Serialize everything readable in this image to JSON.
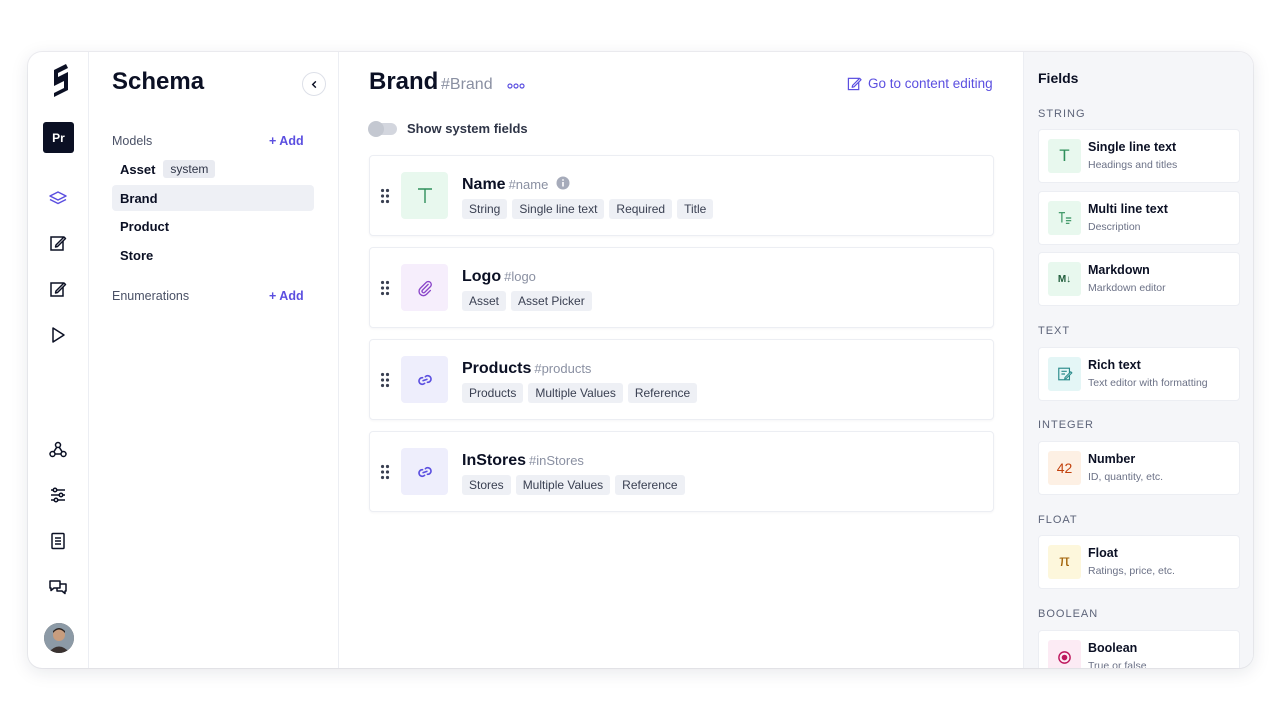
{
  "rail": {
    "project_initials": "Pr"
  },
  "schema": {
    "title": "Schema",
    "models_label": "Models",
    "enumerations_label": "Enumerations",
    "add_label": "+ Add",
    "models": [
      {
        "name": "Asset",
        "badge": "system"
      },
      {
        "name": "Brand"
      },
      {
        "name": "Product"
      },
      {
        "name": "Store"
      }
    ]
  },
  "main": {
    "title": "Brand",
    "api_id": "#Brand",
    "goto_label": "Go to content editing",
    "toggle_label": "Show system fields",
    "fields": [
      {
        "name": "Name",
        "api": "#name",
        "tags": [
          "String",
          "Single line text",
          "Required",
          "Title"
        ]
      },
      {
        "name": "Logo",
        "api": "#logo",
        "tags": [
          "Asset",
          "Asset Picker"
        ]
      },
      {
        "name": "Products",
        "api": "#products",
        "tags": [
          "Products",
          "Multiple Values",
          "Reference"
        ]
      },
      {
        "name": "InStores",
        "api": "#inStores",
        "tags": [
          "Stores",
          "Multiple Values",
          "Reference"
        ]
      }
    ]
  },
  "fields_panel": {
    "title": "Fields",
    "categories": [
      {
        "label": "STRING",
        "types": [
          {
            "name": "Single line text",
            "desc": "Headings and titles",
            "glyph": "T"
          },
          {
            "name": "Multi line text",
            "desc": "Description",
            "glyph": ""
          },
          {
            "name": "Markdown",
            "desc": "Markdown editor",
            "glyph": "M↓"
          }
        ]
      },
      {
        "label": "TEXT",
        "types": [
          {
            "name": "Rich text",
            "desc": "Text editor with formatting",
            "glyph": ""
          }
        ]
      },
      {
        "label": "INTEGER",
        "types": [
          {
            "name": "Number",
            "desc": "ID, quantity, etc.",
            "glyph": "42"
          }
        ]
      },
      {
        "label": "FLOAT",
        "types": [
          {
            "name": "Float",
            "desc": "Ratings, price, etc.",
            "glyph": "π"
          }
        ]
      },
      {
        "label": "BOOLEAN",
        "types": [
          {
            "name": "Boolean",
            "desc": "True or false",
            "glyph": ""
          }
        ]
      }
    ]
  },
  "colors": {
    "accent": "#5b4fe0",
    "string_icon_bg": "#e8f8ee",
    "asset_icon_bg": "#f6eefc",
    "reference_icon_bg": "#eeeefc",
    "number_icon_bg": "#fdf0e4",
    "float_icon_bg": "#fdf7dc",
    "boolean_icon_bg": "#fcebf4"
  }
}
